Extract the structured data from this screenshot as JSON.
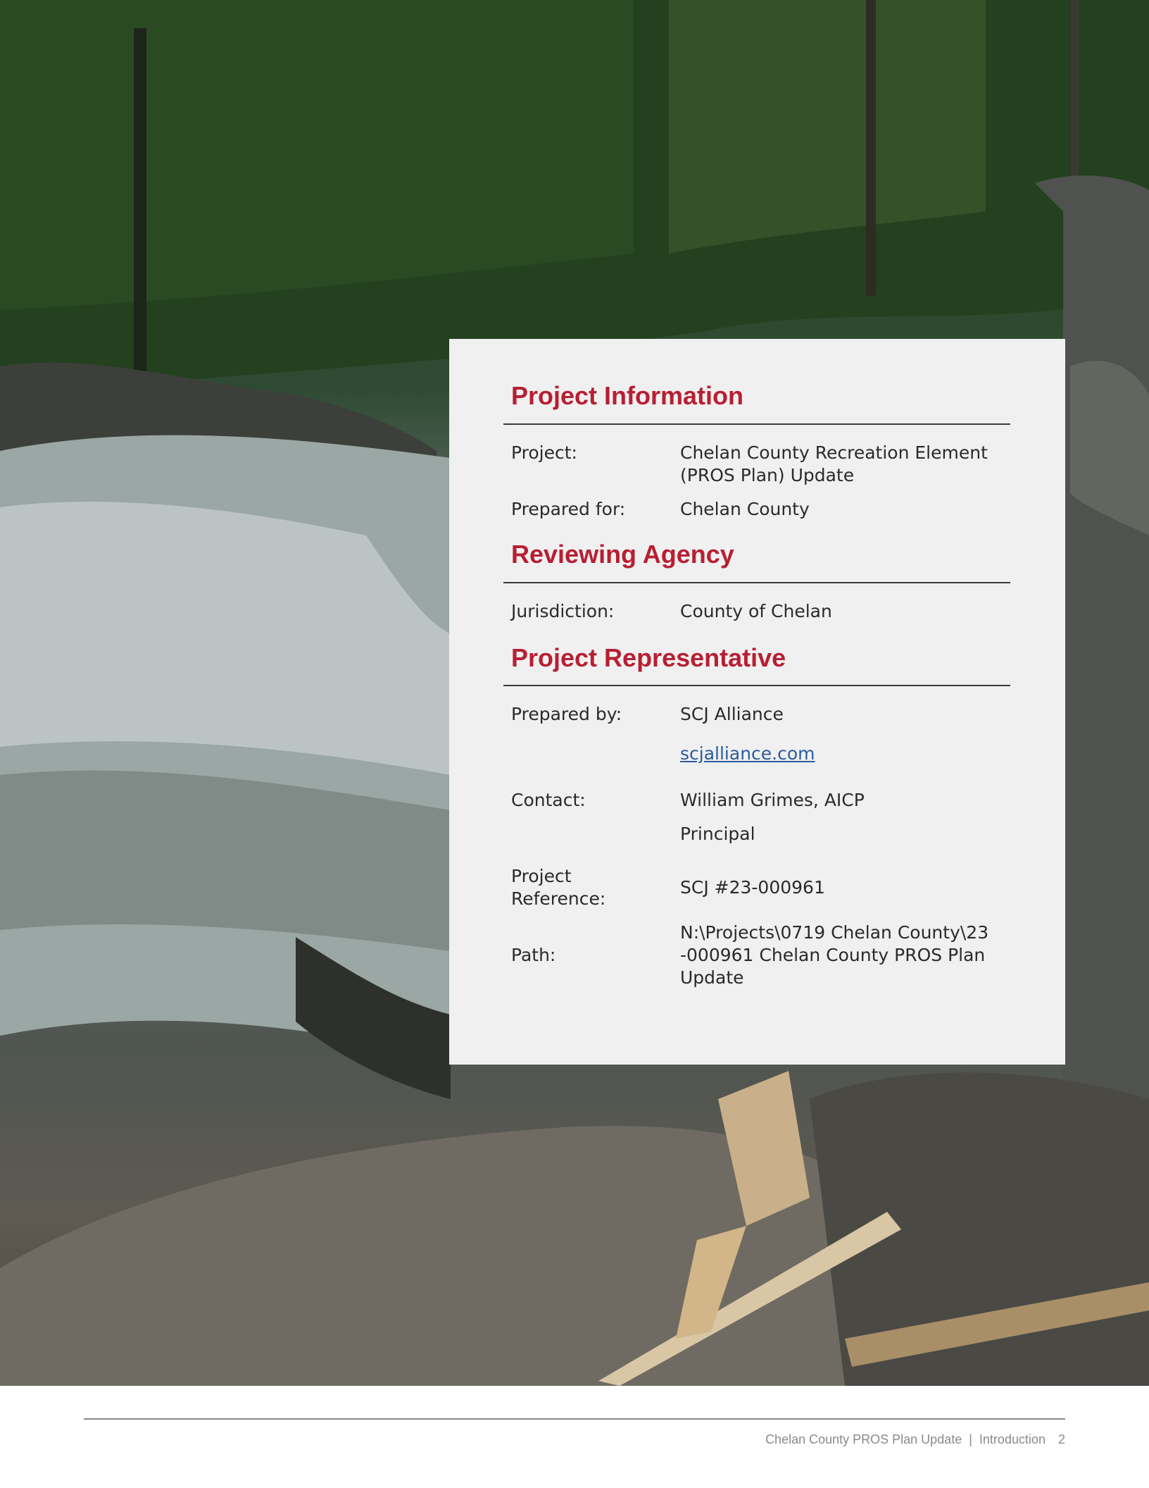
{
  "photo": {
    "description_icon": "river-photo"
  },
  "sections": {
    "project_information": {
      "title": "Project Information",
      "project_label": "Project:",
      "project_value": "Chelan County Recreation Element (PROS Plan) Update",
      "prepared_for_label": "Prepared for:",
      "prepared_for_value": "Chelan County"
    },
    "reviewing_agency": {
      "title": "Reviewing Agency",
      "jurisdiction_label": "Jurisdiction:",
      "jurisdiction_value": "County of Chelan"
    },
    "project_representative": {
      "title": "Project Representative",
      "prepared_by_label": "Prepared by:",
      "prepared_by_value": "SCJ Alliance",
      "website": "scjalliance.com",
      "contact_label": "Contact:",
      "contact_name": "William Grimes, AICP",
      "contact_title": "Principal",
      "reference_label": "Project Reference:",
      "reference_value": "SCJ #23-000961",
      "path_label": "Path:",
      "path_value": "N:\\Projects\\0719 Chelan County\\23-000961 Chelan County PROS Plan Update"
    }
  },
  "footer": {
    "document": "Chelan County PROS Plan Update",
    "separator": "|",
    "section": "Introduction",
    "page": "2"
  },
  "colors": {
    "heading": "#b71f33",
    "card": "#f0f0f0",
    "link": "#2a5d9c"
  }
}
